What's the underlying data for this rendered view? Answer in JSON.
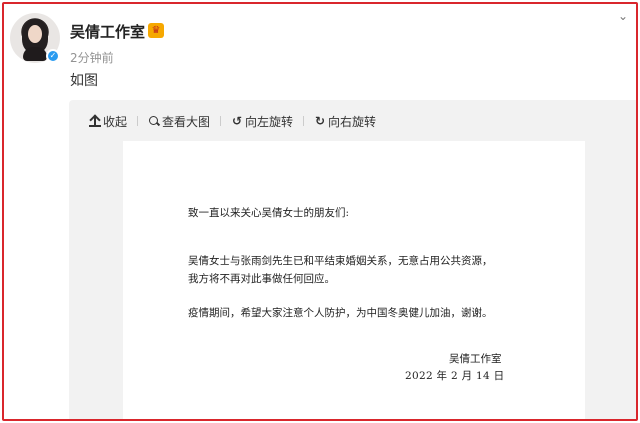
{
  "post": {
    "user_name": "吴倩工作室",
    "time": "2分钟前",
    "text": "如图"
  },
  "toolbar": {
    "collapse": "收起",
    "view_large": "查看大图",
    "rotate_left": "向左旋转",
    "rotate_right": "向右旋转"
  },
  "document": {
    "greeting": "致一直以来关心吴倩女士的朋友们:",
    "line1": "吴倩女士与张雨剑先生已和平结束婚姻关系，无意占用公共资源，",
    "line2": "我方将不再对此事做任何回应。",
    "line3": "疫情期间，希望大家注意个人防护，为中国冬奥健儿加油，谢谢。",
    "signature": "吴倩工作室",
    "date": "2022 年 2 月 14 日"
  },
  "colors": {
    "frame_border": "#d9262c",
    "verify_badge": "#2a9bf0",
    "panel_bg": "#f2f2f2"
  },
  "icons": [
    "verified-icon",
    "crown-badge-icon",
    "chevron-down-icon",
    "upload-icon",
    "search-icon",
    "rotate-left-icon",
    "rotate-right-icon"
  ]
}
